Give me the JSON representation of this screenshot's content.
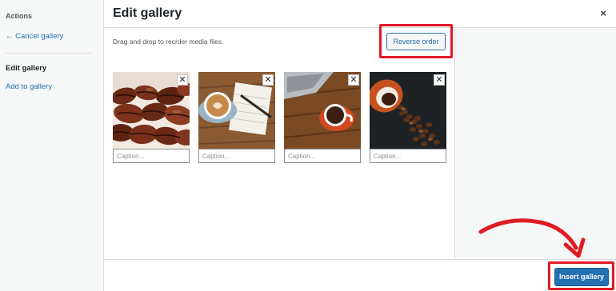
{
  "sidebar": {
    "actions_heading": "Actions",
    "cancel_gallery": "← Cancel gallery",
    "edit_gallery": "Edit gallery",
    "add_to_gallery": "Add to gallery"
  },
  "header": {
    "title": "Edit gallery",
    "close_glyph": "×"
  },
  "instructions": "Drag and drop to recrder media files.",
  "reverse_order_label": "Reverse order",
  "remove_glyph": "✕",
  "items": [
    {
      "subject": "coffee beans close-up",
      "caption_placeholder": "Caption..."
    },
    {
      "subject": "latte cup with notebook and pen",
      "caption_placeholder": "Caption..."
    },
    {
      "subject": "orange coffee cup on wooden table with laptop",
      "caption_placeholder": "Caption..."
    },
    {
      "subject": "tipped cup spilling coffee beans on dark background",
      "caption_placeholder": "Caption..."
    }
  ],
  "footer": {
    "insert_gallery_label": "Insert gallery"
  },
  "colors": {
    "accent": "#2271b1",
    "highlight": "#e01b24"
  }
}
